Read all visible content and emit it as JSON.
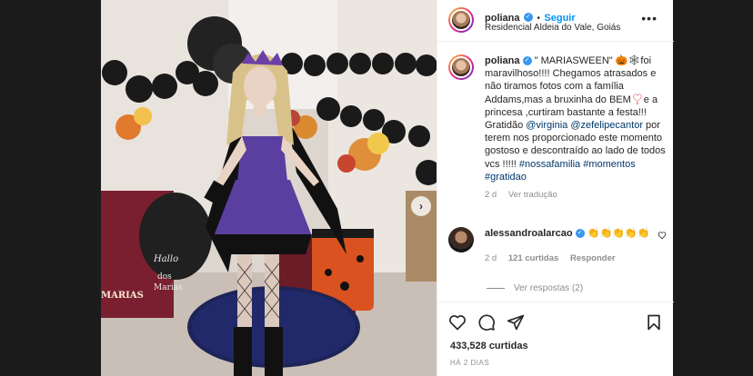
{
  "header": {
    "username": "poliana",
    "follow_label": "Seguir",
    "separator": "•",
    "location": "Residencial Aldeia do Vale, Goiás"
  },
  "caption": {
    "username": "poliana",
    "text_1": " \" MARIASWEEN\" ",
    "emoji_1": "🎃",
    "emoji_2": "🕸",
    "text_2": "foi maravilhoso!!!! Chegamos atrasados e não tiramos fotos com a família Addams,mas a bruxinha do BEM",
    "emoji_3": "❣",
    "text_3": "e a princesa ,curtiram bastante a festa!!! Gratidão ",
    "mention_1": "@virginia",
    "mention_2": "@zefelipecantor",
    "text_4": " por terem nos proporcionado este momento gostoso e descontraído ao lado de todos vcs !!!!! ",
    "hashtag_1": "#nossafamilia",
    "hashtag_2": "#momentos",
    "hashtag_3": "#gratidao",
    "time": "2 d",
    "translate": "Ver tradução"
  },
  "comment": {
    "username": "alessandroalarcao",
    "emojis": "👏👏👏👏👏",
    "time": "2 d",
    "likes": "121 curtidas",
    "reply": "Responder",
    "view_replies": "Ver respostas (2)"
  },
  "footer": {
    "likes": "433,528 curtidas",
    "ago": "HÁ 2 DIAS"
  },
  "photo": {
    "sign_text_1": "Hallo",
    "sign_text_2": "dos",
    "sign_text_3": "Marias",
    "sign_text_4": "MARIAS"
  },
  "colors": {
    "accent_blue": "#0095f6",
    "link_navy": "#00376b",
    "muted_gray": "#8e8e8e",
    "dress_purple": "#5a3fa0"
  },
  "icons": {
    "verified": "verified-badge-icon",
    "more": "more-options-icon",
    "like": "heart-icon",
    "comment": "comment-icon",
    "share": "send-icon",
    "save": "bookmark-icon",
    "next": "chevron-right-icon"
  }
}
